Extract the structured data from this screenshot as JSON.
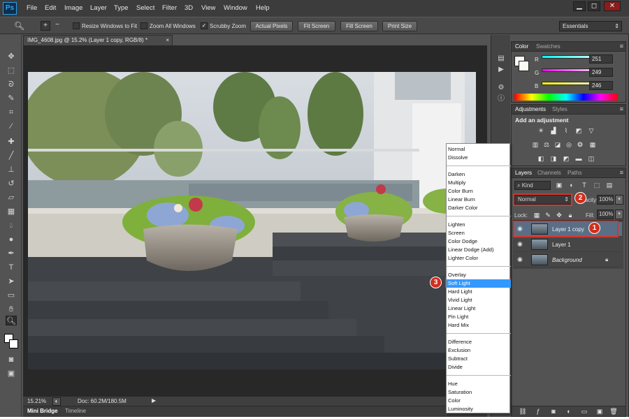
{
  "app": {
    "logo": "Ps"
  },
  "menu": [
    "File",
    "Edit",
    "Image",
    "Layer",
    "Type",
    "Select",
    "Filter",
    "3D",
    "View",
    "Window",
    "Help"
  ],
  "window_controls": {
    "minimize": "▁",
    "restore": "◻",
    "close": "✕"
  },
  "options_bar": {
    "resize_windows": "Resize Windows to Fit",
    "zoom_all_windows": "Zoom All Windows",
    "scrubby_zoom": "Scrubby Zoom",
    "actual_pixels": "Actual Pixels",
    "fit_screen": "Fit Screen",
    "fill_screen": "Fill Screen",
    "print_size": "Print Size",
    "workspace": "Essentials",
    "scrubby_checked": true
  },
  "document": {
    "tab_title": "IMG_4608.jpg @ 15.2% (Layer 1 copy, RGB/8) *",
    "tab_close": "×",
    "zoom": "15.21%",
    "doc_info": "Doc: 60.2M/180.5M"
  },
  "bottom_tabs": [
    "Mini Bridge",
    "Timeline"
  ],
  "color_panel": {
    "tabs": [
      "Color",
      "Swatches"
    ],
    "r_label": "R",
    "g_label": "G",
    "b_label": "B",
    "r": "251",
    "g": "249",
    "b": "246"
  },
  "adjustments_panel": {
    "tabs": [
      "Adjustments",
      "Styles"
    ],
    "heading": "Add an adjustment"
  },
  "layers_panel": {
    "tabs": [
      "Layers",
      "Channels",
      "Paths"
    ],
    "kind": "Kind",
    "blend_mode": "Normal",
    "opacity_label": "Opacity:",
    "opacity": "100%",
    "lock_label": "Lock:",
    "fill_label": "Fill:",
    "fill": "100%",
    "layers": [
      {
        "name": "Layer 1 copy",
        "selected": true
      },
      {
        "name": "Layer 1",
        "selected": false
      },
      {
        "name": "Background",
        "selected": false
      }
    ]
  },
  "blend_dropdown": {
    "groups": [
      [
        "Normal",
        "Dissolve"
      ],
      [
        "Darken",
        "Multiply",
        "Color Burn",
        "Linear Burn",
        "Darker Color"
      ],
      [
        "Lighten",
        "Screen",
        "Color Dodge",
        "Linear Dodge (Add)",
        "Lighter Color"
      ],
      [
        "Overlay",
        "Soft Light",
        "Hard Light",
        "Vivid Light",
        "Linear Light",
        "Pin Light",
        "Hard Mix"
      ],
      [
        "Difference",
        "Exclusion",
        "Subtract",
        "Divide"
      ],
      [
        "Hue",
        "Saturation",
        "Color",
        "Luminosity"
      ]
    ],
    "selected": "Soft Light"
  },
  "callouts": [
    "1",
    "2",
    "3"
  ],
  "colors": {
    "accent_red": "#d9342b",
    "selection_blue": "#3399ff"
  }
}
